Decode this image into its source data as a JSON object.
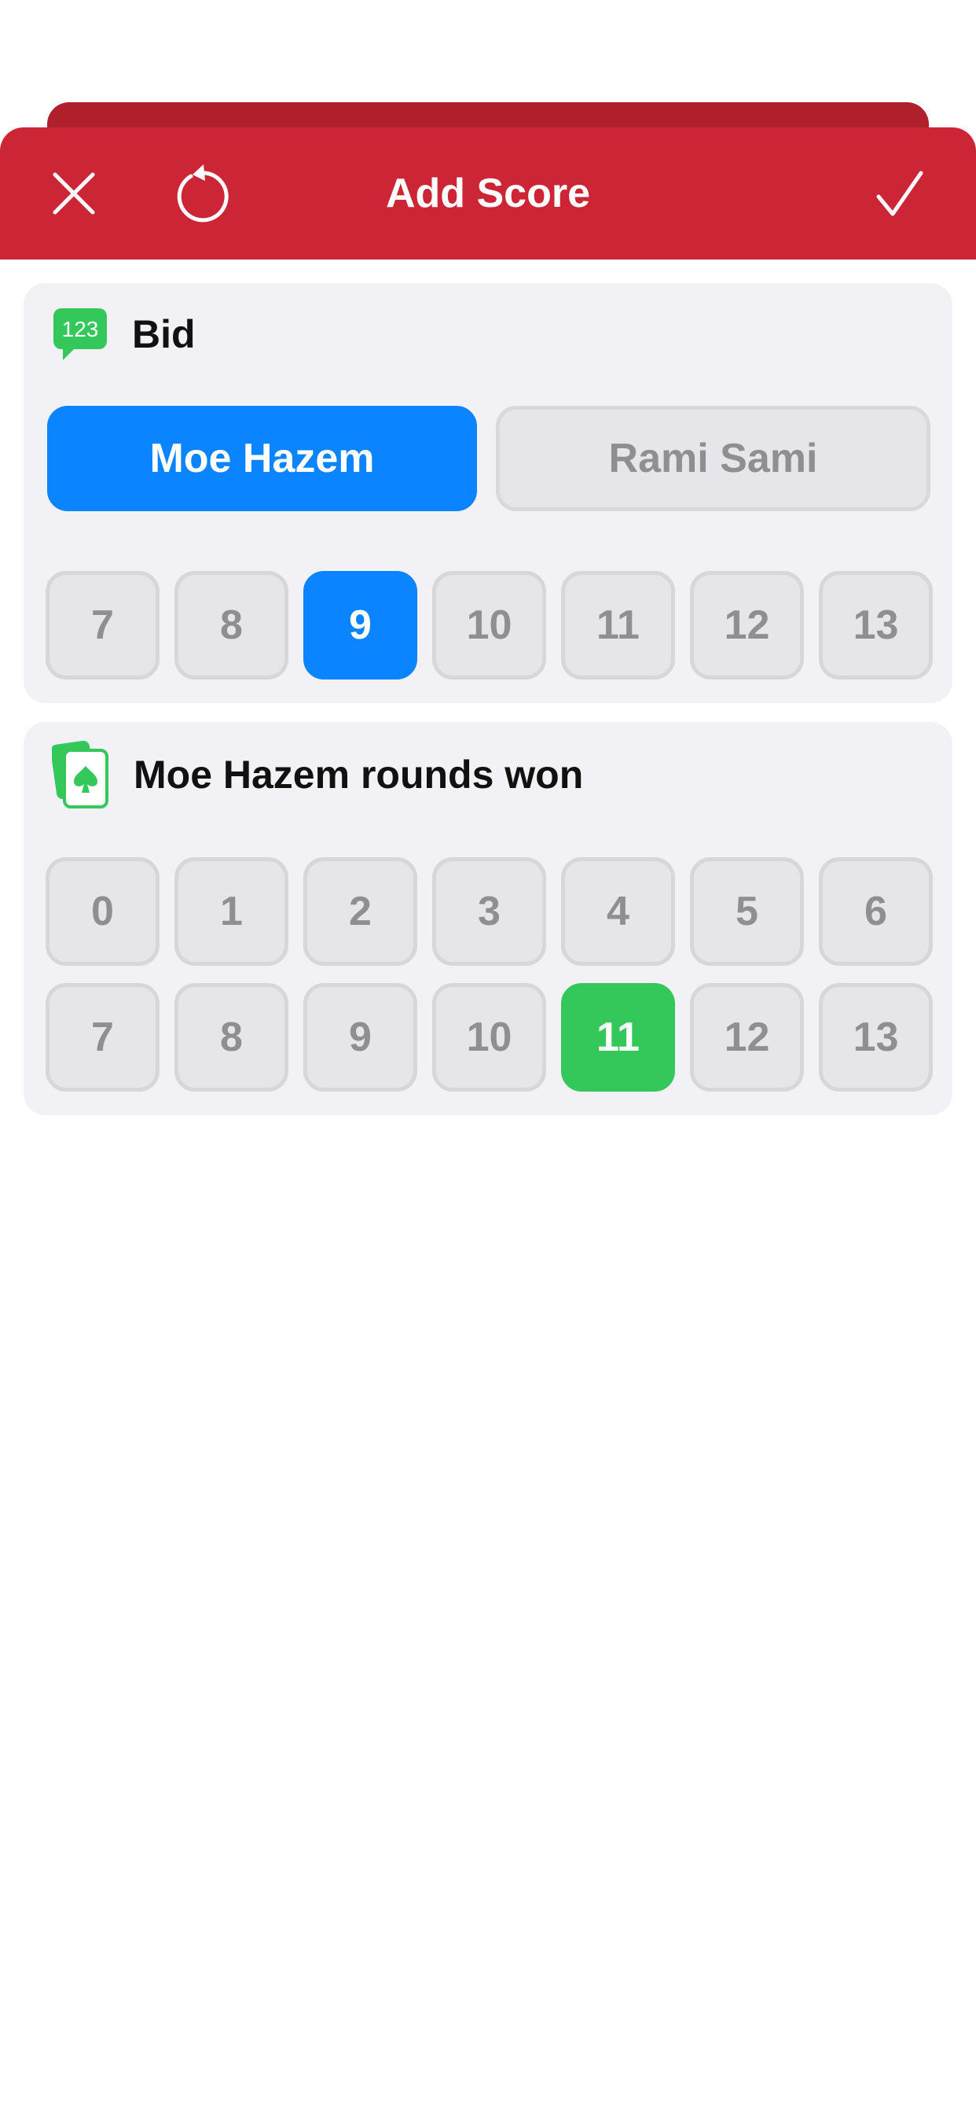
{
  "header": {
    "title": "Add Score",
    "close_icon": "close-icon",
    "reset_icon": "reset-icon",
    "done_icon": "checkmark-icon",
    "color": "#cc2636"
  },
  "bid_section": {
    "icon": "numbers-bubble-icon",
    "label": "Bid",
    "players": [
      {
        "name": "Moe Hazem",
        "selected": true
      },
      {
        "name": "Rami Sami",
        "selected": false
      }
    ],
    "options": [
      "7",
      "8",
      "9",
      "10",
      "11",
      "12",
      "13"
    ],
    "selected": "9",
    "accent": "#0a84ff"
  },
  "won_section": {
    "icon": "playing-cards-icon",
    "label": "Moe Hazem rounds won",
    "options_row1": [
      "0",
      "1",
      "2",
      "3",
      "4",
      "5",
      "6"
    ],
    "options_row2": [
      "7",
      "8",
      "9",
      "10",
      "11",
      "12",
      "13"
    ],
    "selected": "11",
    "accent": "#34c759"
  }
}
